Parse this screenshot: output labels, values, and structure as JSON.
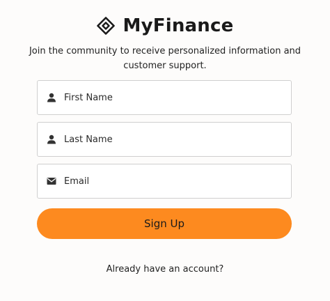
{
  "brand": {
    "name": "MyFinance",
    "icon": "diamond-logo-icon"
  },
  "tagline": "Join the community to receive personalized information and customer support.",
  "form": {
    "first_name": {
      "placeholder": "First Name",
      "value": "",
      "icon": "user-icon"
    },
    "last_name": {
      "placeholder": "Last Name",
      "value": "",
      "icon": "user-icon"
    },
    "email": {
      "placeholder": "Email",
      "value": "",
      "icon": "envelope-icon"
    },
    "submit_label": "Sign Up"
  },
  "footer": {
    "login_prompt": "Already have an account?"
  },
  "colors": {
    "accent": "#fd8a1f",
    "background": "#fdfcfb",
    "border": "#cfcfcf"
  }
}
